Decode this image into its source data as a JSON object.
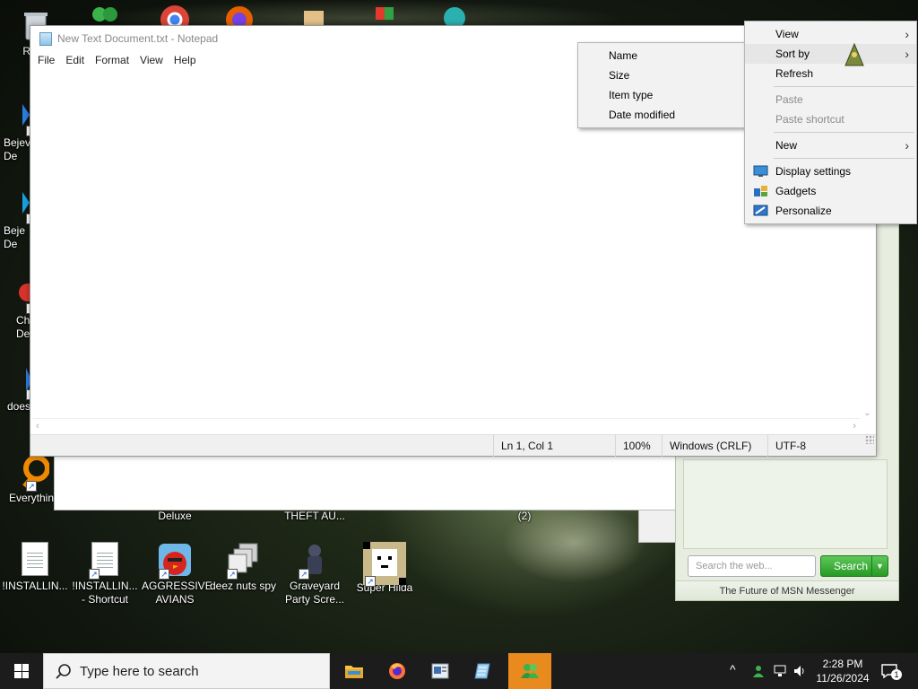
{
  "desktop": {
    "icons_top": [
      {
        "label": "Recy"
      },
      {
        "label": "Bejev\nDe"
      },
      {
        "label": "Beje\nDe"
      },
      {
        "label": "Ch\nDe"
      },
      {
        "label": "does"
      },
      {
        "label": "Everythin"
      }
    ],
    "icons_bottom": [
      {
        "label": "!INSTALLIN..."
      },
      {
        "label": "!INSTALLIN...\n- Shortcut"
      },
      {
        "label": "AGGRESSIVE\nAVIANS"
      },
      {
        "label": "deez nuts spy"
      },
      {
        "label": "Graveyard\nParty Scre..."
      },
      {
        "label": "Super Hilda"
      }
    ],
    "partial_labels": [
      {
        "label": "Deluxe"
      },
      {
        "label": "THEFT AU..."
      },
      {
        "label": "(2)"
      }
    ]
  },
  "notepad": {
    "title": "New Text Document.txt - Notepad",
    "menu": [
      "File",
      "Edit",
      "Format",
      "View",
      "Help"
    ],
    "content": "",
    "status": {
      "position": "Ln 1, Col 1",
      "zoom": "100%",
      "line_ending": "Windows (CRLF)",
      "encoding": "UTF-8"
    }
  },
  "context_menu": {
    "items": [
      {
        "label": "View",
        "disabled": false,
        "submenu": true
      },
      {
        "label": "Sort by",
        "disabled": false,
        "submenu": true
      },
      {
        "label": "Refresh",
        "disabled": false,
        "submenu": false
      },
      {
        "label": "Paste",
        "disabled": true,
        "submenu": false
      },
      {
        "label": "Paste shortcut",
        "disabled": true,
        "submenu": false
      },
      {
        "label": "New",
        "disabled": false,
        "submenu": true
      },
      {
        "label": "Display settings",
        "disabled": false,
        "icon": "display-icon"
      },
      {
        "label": "Gadgets",
        "disabled": false,
        "icon": "gadgets-icon"
      },
      {
        "label": "Personalize",
        "disabled": false,
        "icon": "personalize-icon"
      }
    ],
    "sort_submenu": [
      "Name",
      "Size",
      "Item type",
      "Date modified"
    ]
  },
  "msn": {
    "search_placeholder": "Search the web...",
    "search_button": "Search",
    "footer": "The Future of MSN Messenger"
  },
  "taskbar": {
    "search_text": "Type here to search",
    "time": "2:28 PM",
    "date": "11/26/2024",
    "notification_count": "1",
    "apps": [
      "file-explorer-icon",
      "firefox-icon",
      "app-icon",
      "notepad-icon",
      "msn-messenger-icon"
    ]
  },
  "colors": {
    "taskbar": "#1c1c1c",
    "active_app": "#e88a1e",
    "msn_green": "#279a25"
  }
}
